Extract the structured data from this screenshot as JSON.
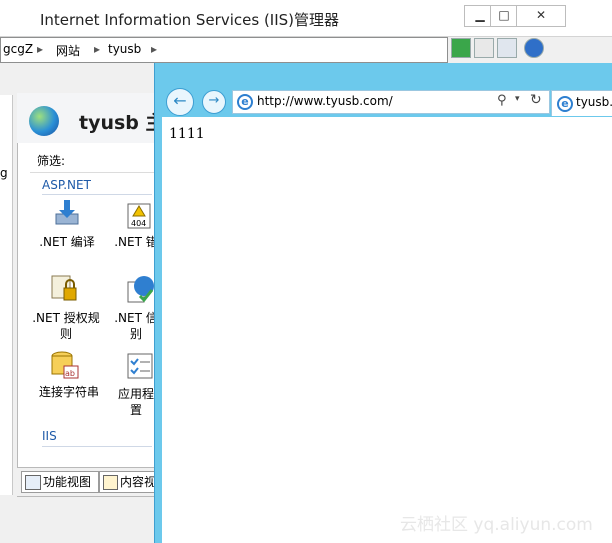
{
  "iis": {
    "title": "Internet Information Services (IIS)管理器",
    "buttons": {
      "minimize": "▁",
      "maximize": "□",
      "close": "✕"
    },
    "breadcrumb": [
      "gcgZ",
      "网站",
      "tyusb"
    ],
    "breadcrumb_separator": "▸",
    "connections_snippet": "g",
    "site_title": "tyusb 主",
    "filter_label": "筛选:",
    "groups": {
      "aspnet": "ASP.NET",
      "iis": "IIS"
    },
    "features": [
      {
        "label": ".NET 编译",
        "icon": "download-arrow-icon"
      },
      {
        "label": ".NET 错",
        "icon": "error-404-icon"
      },
      {
        "label": ".NET 授权规\n则",
        "icon": "lock-document-icon"
      },
      {
        "label": ".NET 信\n别",
        "icon": "globe-check-icon"
      },
      {
        "label": "连接字符串",
        "icon": "database-ab-icon"
      },
      {
        "label": "应用程\n置",
        "icon": "checklist-icon"
      }
    ],
    "view_tabs": [
      "功能视图",
      "内容视"
    ],
    "accent_color": "#1e5aa8"
  },
  "ie": {
    "url": "http://www.tyusb.com/",
    "tab_label": "tyusb.",
    "page_text": "1111",
    "frame_color": "#6cc9ec"
  },
  "watermark": "云栖社区 yq.aliyun.com"
}
